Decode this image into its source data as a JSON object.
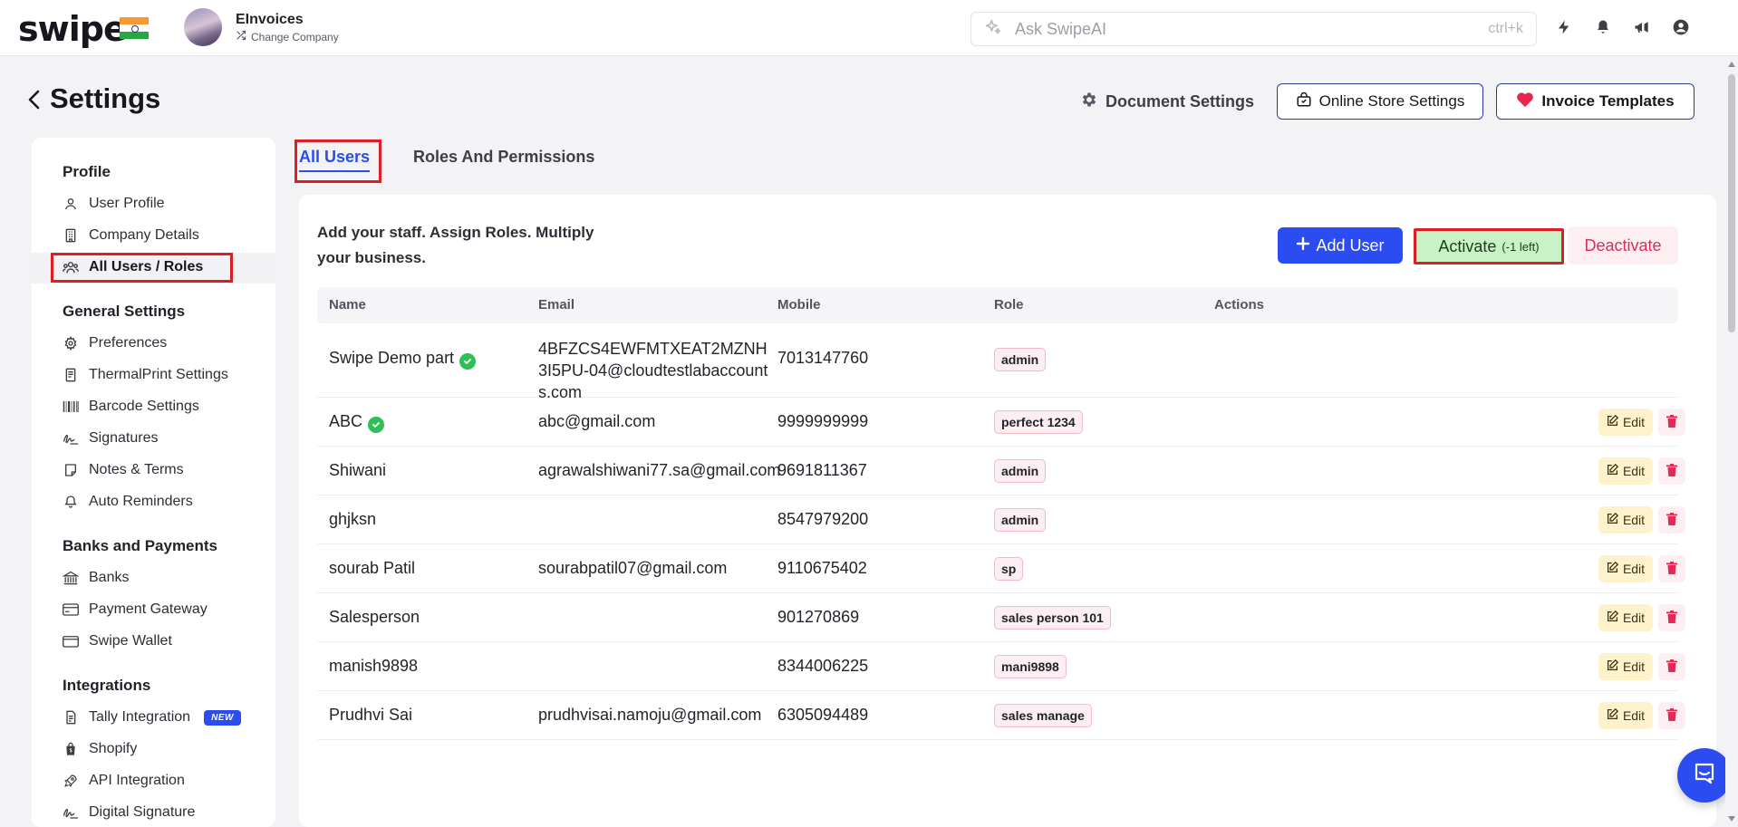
{
  "app": {
    "logo_text": "swipe",
    "company_name": "EInvoices",
    "change_company_label": "Change Company",
    "ai_search_placeholder": "Ask SwipeAI",
    "ai_search_shortcut": "ctrl+k"
  },
  "header": {
    "title": "Settings",
    "document_settings_label": "Document Settings",
    "online_store_settings_label": "Online Store Settings",
    "invoice_templates_label": "Invoice Templates"
  },
  "sidebar": {
    "sections": [
      {
        "title": "Profile",
        "items": [
          {
            "label": "User Profile",
            "icon": "user-icon"
          },
          {
            "label": "Company Details",
            "icon": "building-icon"
          },
          {
            "label": "All Users / Roles",
            "icon": "users-icon",
            "active": true
          }
        ]
      },
      {
        "title": "General Settings",
        "items": [
          {
            "label": "Preferences",
            "icon": "gear-icon"
          },
          {
            "label": "ThermalPrint Settings",
            "icon": "receipt-icon"
          },
          {
            "label": "Barcode Settings",
            "icon": "barcode-icon"
          },
          {
            "label": "Signatures",
            "icon": "signature-icon"
          },
          {
            "label": "Notes & Terms",
            "icon": "note-icon"
          },
          {
            "label": "Auto Reminders",
            "icon": "bell-icon"
          }
        ]
      },
      {
        "title": "Banks and Payments",
        "items": [
          {
            "label": "Banks",
            "icon": "bank-icon"
          },
          {
            "label": "Payment Gateway",
            "icon": "card-icon"
          },
          {
            "label": "Swipe Wallet",
            "icon": "wallet-icon"
          }
        ]
      },
      {
        "title": "Integrations",
        "items": [
          {
            "label": "Tally Integration",
            "icon": "document-icon",
            "badge": "NEW"
          },
          {
            "label": "Shopify",
            "icon": "shopping-bag-icon"
          },
          {
            "label": "API Integration",
            "icon": "rocket-icon"
          },
          {
            "label": "Digital Signature",
            "icon": "signature-icon"
          }
        ]
      }
    ]
  },
  "tabs": {
    "all_users": "All Users",
    "roles_permissions": "Roles And Permissions"
  },
  "users_panel": {
    "tagline": "Add your staff. Assign Roles. Multiply your business.",
    "add_user_label": "Add User",
    "activate_label": "Activate",
    "activate_note": "(-1 left)",
    "deactivate_label": "Deactivate",
    "columns": [
      "Name",
      "Email",
      "Mobile",
      "Role",
      "Actions"
    ],
    "edit_label": "Edit",
    "rows": [
      {
        "name": "Swipe Demo part",
        "verified": true,
        "email": "4BFZCS4EWFMTXEAT2MZNH3I5PU-04@cloudtestlabaccounts.com",
        "mobile": "7013147760",
        "role": "admin",
        "actions": false
      },
      {
        "name": "ABC",
        "verified": true,
        "email": "abc@gmail.com",
        "mobile": "9999999999",
        "role": "perfect 1234",
        "actions": true
      },
      {
        "name": "Shiwani",
        "verified": false,
        "email": "agrawalshiwani77.sa@gmail.com",
        "mobile": "9691811367",
        "role": "admin",
        "actions": true
      },
      {
        "name": "ghjksn",
        "verified": false,
        "email": "",
        "mobile": "8547979200",
        "role": "admin",
        "actions": true
      },
      {
        "name": "sourab Patil",
        "verified": false,
        "email": "sourabpatil07@gmail.com",
        "mobile": "9110675402",
        "role": "sp",
        "actions": true
      },
      {
        "name": "Salesperson",
        "verified": false,
        "email": "",
        "mobile": "901270869",
        "role": "sales person 101",
        "actions": true
      },
      {
        "name": "manish9898",
        "verified": false,
        "email": "",
        "mobile": "8344006225",
        "role": "mani9898",
        "actions": true
      },
      {
        "name": "Prudhvi Sai",
        "verified": false,
        "email": "prudhvisai.namoju@gmail.com",
        "mobile": "6305094489",
        "role": "sales manage",
        "actions": true
      }
    ]
  },
  "colors": {
    "accent": "#2b4cf0",
    "highlight": "#dc1f26",
    "activate_bg": "#c9f2c6",
    "deactivate_text": "#e02b57"
  }
}
